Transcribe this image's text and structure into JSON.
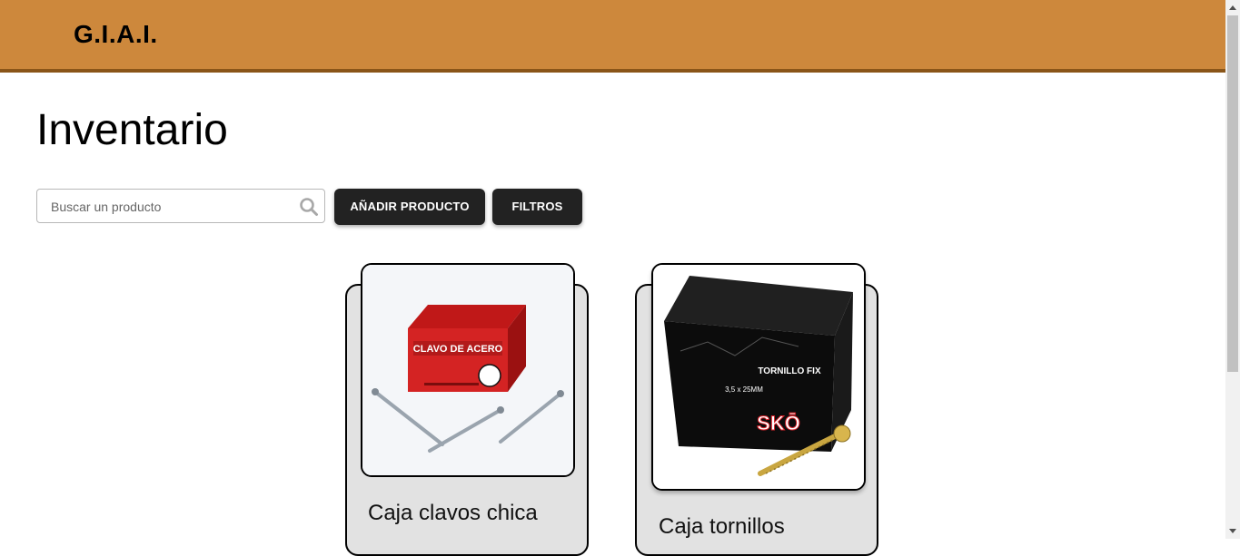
{
  "header": {
    "brand": "G.I.A.I."
  },
  "page": {
    "title": "Inventario"
  },
  "toolbar": {
    "search_placeholder": "Buscar un producto",
    "add_label": "AÑADIR PRODUCTO",
    "filter_label": "FILTROS"
  },
  "products": [
    {
      "name": "Caja clavos chica",
      "image_text": "CLAVO DE ACERO"
    },
    {
      "name": "Caja tornillos",
      "image_text": "TORNILLO FIX",
      "image_subtext": "3,5 x 25MM",
      "brand_mark": "SKŌ"
    }
  ],
  "colors": {
    "header": "#cd883c",
    "header_border": "#8a5518",
    "button": "#222222",
    "card": "#e2e2e2"
  }
}
